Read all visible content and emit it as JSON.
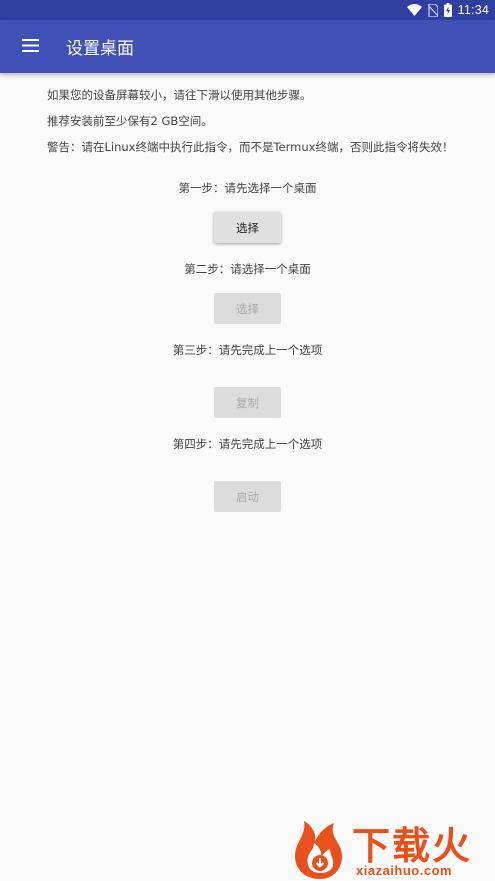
{
  "status_bar": {
    "time": "11:34",
    "icons": [
      "wifi-icon",
      "no-sim-icon",
      "battery-charging-icon"
    ]
  },
  "app_bar": {
    "title": "设置桌面",
    "menu_icon": "hamburger-menu-icon"
  },
  "info": {
    "line1": "如果您的设备屏幕较小，请往下滑以使用其他步骤。",
    "line2": "推荐安装前至少保有2 GB空间。",
    "line3": "警告：请在Linux终端中执行此指令，而不是Termux终端，否则此指令将失效！"
  },
  "steps": [
    {
      "label": "第一步：请先选择一个桌面",
      "button": "选择",
      "enabled": true
    },
    {
      "label": "第二步：请选择一个桌面",
      "button": "选择",
      "enabled": false
    },
    {
      "label": "第三步：请先完成上一个选项",
      "button": "复制",
      "enabled": false
    },
    {
      "label": "第四步：请先完成上一个选项",
      "button": "启动",
      "enabled": false
    }
  ],
  "watermark": {
    "text": "下载火",
    "url_text": "xiazaihuo.com"
  },
  "colors": {
    "status_bar": "#303f9f",
    "app_bar": "#3f51b5",
    "background": "#fafafa",
    "watermark": "#e8501c"
  }
}
